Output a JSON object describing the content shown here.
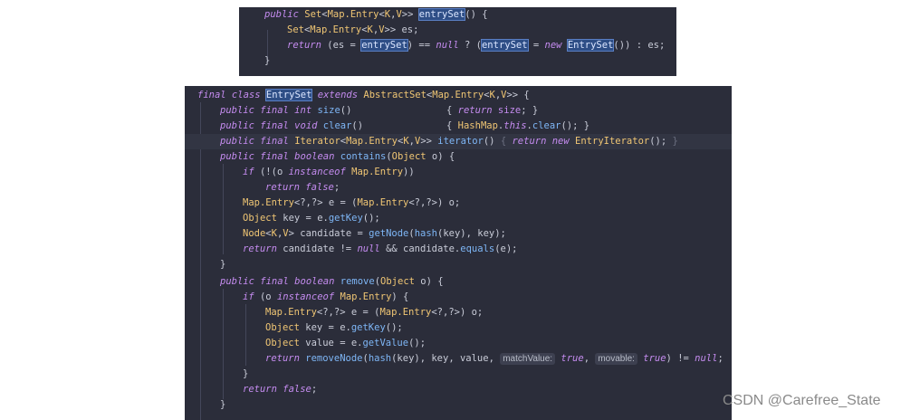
{
  "top_panel": {
    "lines": [
      "public Set<Map.Entry<K,V>> entrySet() {",
      "Set<Map.Entry<K,V>> es;",
      "return (es = entrySet) == null ? (entrySet = new EntrySet()) : es;",
      "}"
    ]
  },
  "bottom_panel": {
    "lines": [
      "final class EntrySet extends AbstractSet<Map.Entry<K,V>> {",
      "public final int size()                 { return size; }",
      "public final void clear()               { HashMap.this.clear(); }",
      "public final Iterator<Map.Entry<K,V>> iterator() { return new EntryIterator(); }",
      "public final boolean contains(Object o) {",
      "if (!(o instanceof Map.Entry))",
      "return false;",
      "Map.Entry<?,?> e = (Map.Entry<?,?>) o;",
      "Object key = e.getKey();",
      "Node<K,V> candidate = getNode(hash(key), key);",
      "return candidate != null && candidate.equals(e);",
      "}",
      "public final boolean remove(Object o) {",
      "if (o instanceof Map.Entry) {",
      "Map.Entry<?,?> e = (Map.Entry<?,?>) o;",
      "Object key = e.getKey();",
      "Object value = e.getValue();",
      "return removeNode(hash(key), key, value, matchValue: true, movable: true) != null;",
      "}",
      "return false;",
      "}"
    ],
    "inlay_hints": [
      "matchValue:",
      "movable:"
    ]
  },
  "watermark": "CSDN @Carefree_State",
  "colors": {
    "editor_bg": "#2b2d3a",
    "keyword": "#c58cf0",
    "type": "#f0c674",
    "function": "#7eb6f6",
    "text": "#c9ccd8",
    "match_highlight": "#2e4e86"
  }
}
